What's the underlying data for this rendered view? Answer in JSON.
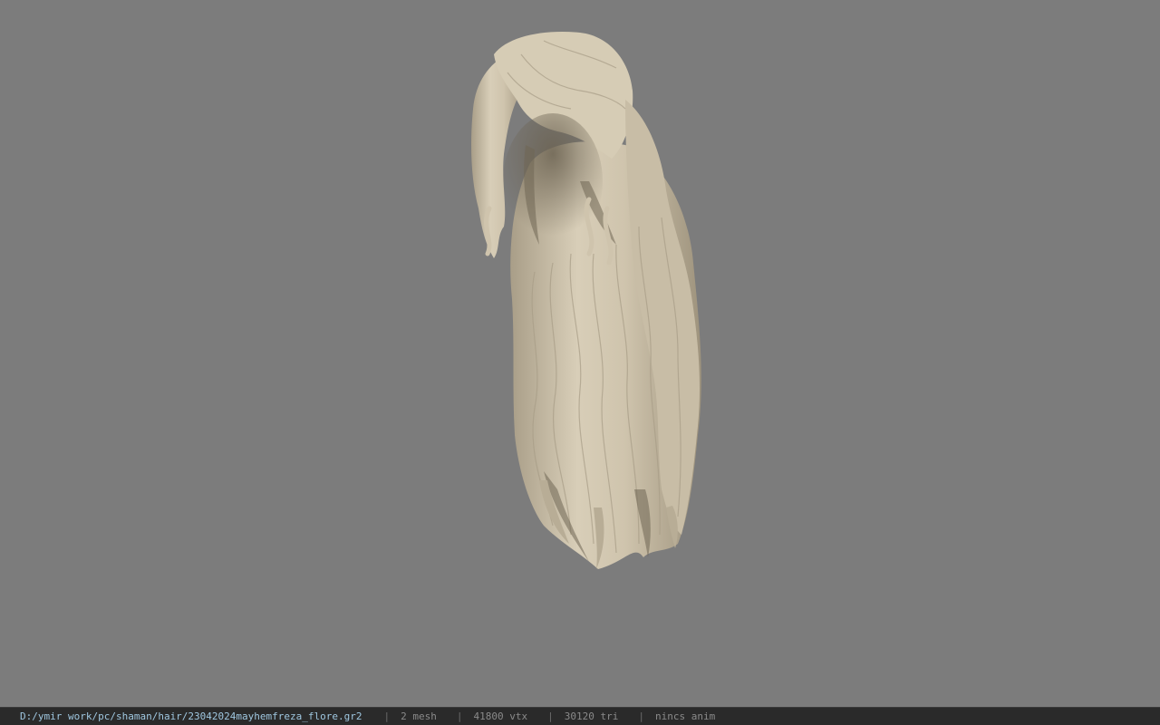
{
  "viewport": {
    "background_color": "#7c7c7c",
    "model": {
      "name": "hair-mesh",
      "base_color": "#cfc4ae",
      "shadow_color": "#6f6654"
    }
  },
  "status_bar": {
    "file_path": "D:/ymir work/pc/shaman/hair/23042024mayhemfreza_flore.gr2",
    "separator": "|",
    "mesh_count": "2 mesh",
    "vertex_count": "41800 vtx",
    "triangle_count": "30120 tri",
    "anim_status": "nincs anim"
  }
}
